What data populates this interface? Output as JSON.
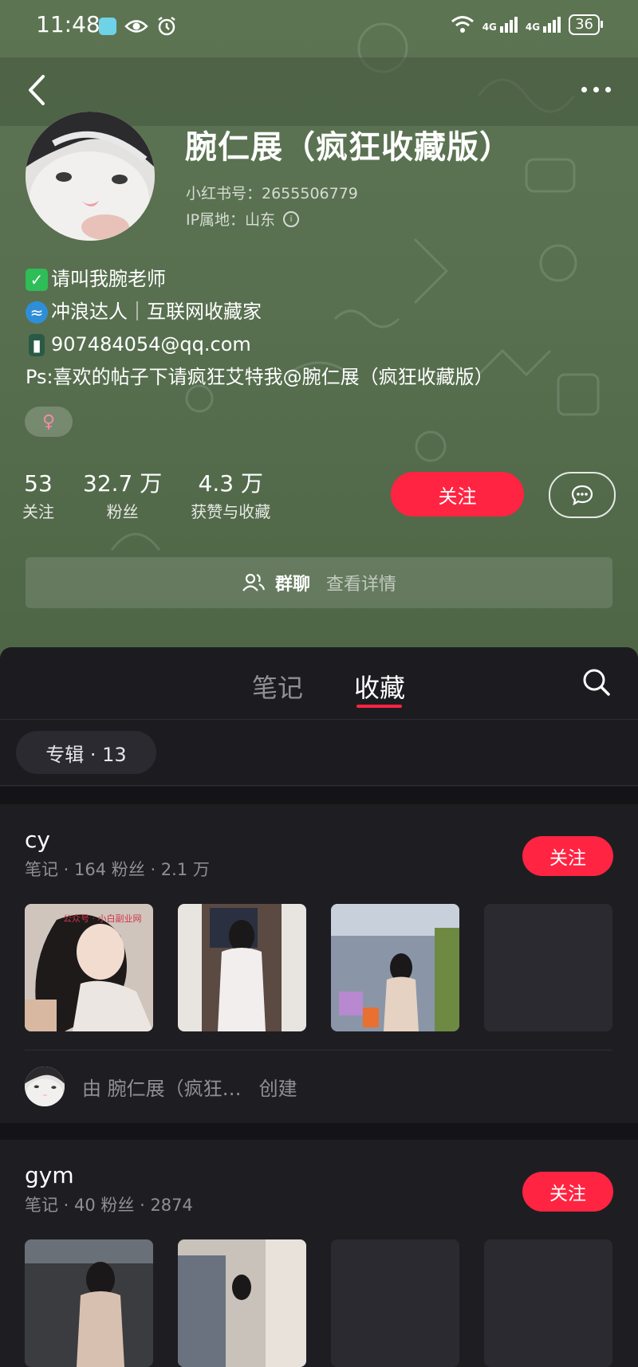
{
  "status_bar": {
    "time": "11:48",
    "network1": "4G",
    "network2": "4G",
    "battery": "36"
  },
  "profile": {
    "name": "腕仁展（疯狂收藏版）",
    "xhs_id": "小红书号：2655506779",
    "ip": "IP属地：山东",
    "bio_lines": [
      "请叫我腕老师",
      "冲浪达人｜互联网收藏家",
      "907484054@qq.com",
      "Ps:喜欢的帖子下请疯狂艾特我@腕仁展（疯狂收藏版）"
    ],
    "gender_symbol": "♀"
  },
  "stats": [
    {
      "value": "53",
      "label": "关注"
    },
    {
      "value": "32.7 万",
      "label": "粉丝"
    },
    {
      "value": "4.3 万",
      "label": "获赞与收藏"
    }
  ],
  "actions": {
    "follow_label": "关注"
  },
  "group_chat": {
    "label": "群聊",
    "detail": "查看详情"
  },
  "tabs": {
    "notes": "笔记",
    "favorites": "收藏"
  },
  "album_chip": "专辑 · 13",
  "albums": [
    {
      "title": "cy",
      "subtitle": "笔记 · 164   粉丝 · 2.1 万",
      "follow_label": "关注",
      "creator_by": "由 腕仁展（疯狂…",
      "creator_suffix": "创建",
      "watermark": "公众号 · 小白副业网"
    },
    {
      "title": "gym",
      "subtitle": "笔记 · 40   粉丝 · 2874",
      "follow_label": "关注"
    }
  ],
  "colors": {
    "accent": "#ff2442",
    "header_bg": "#587050",
    "panel_bg": "#1c1c20"
  }
}
